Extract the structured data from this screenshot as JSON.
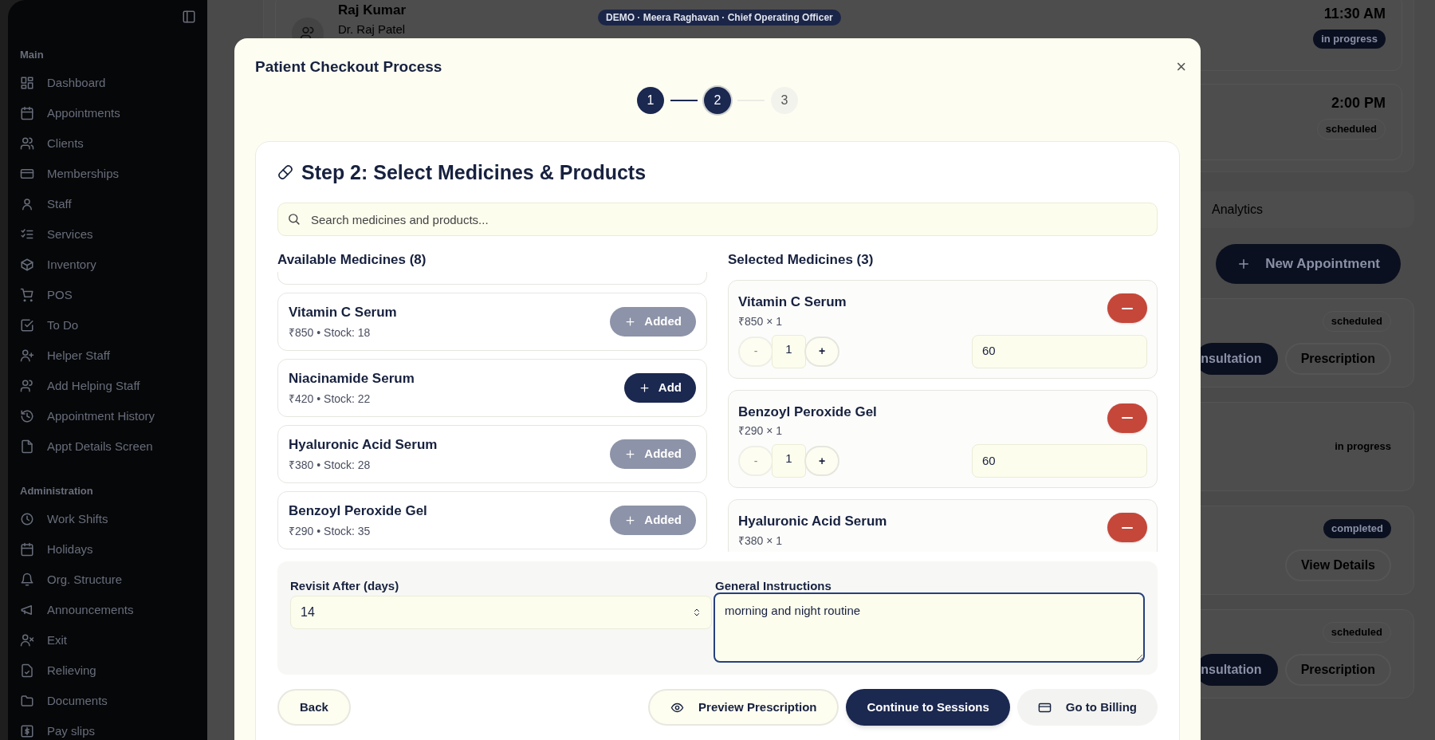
{
  "sidebar": {
    "sections": [
      {
        "title": "Main",
        "items": [
          {
            "label": "Dashboard"
          },
          {
            "label": "Appointments"
          },
          {
            "label": "Clients"
          },
          {
            "label": "Memberships"
          },
          {
            "label": "Staff"
          },
          {
            "label": "Services"
          },
          {
            "label": "Inventory"
          },
          {
            "label": "POS"
          },
          {
            "label": "To Do"
          },
          {
            "label": "Helper Staff"
          },
          {
            "label": "Add Helping Staff"
          },
          {
            "label": "Appointment History"
          },
          {
            "label": "Appt Details Screen"
          }
        ]
      },
      {
        "title": "Administration",
        "items": [
          {
            "label": "Work Shifts"
          },
          {
            "label": "Holidays"
          },
          {
            "label": "Org. Structure"
          },
          {
            "label": "Announcements"
          },
          {
            "label": "Exit"
          },
          {
            "label": "Relieving"
          },
          {
            "label": "Documents"
          },
          {
            "label": "Pay slips"
          }
        ]
      }
    ]
  },
  "demo_badge": "DEMO · Meera Raghavan · Chief Operating Officer",
  "background": {
    "top_cards": [
      {
        "name": "Raj Kumar",
        "doctor": "Dr. Raj Patel",
        "time": "11:30 AM",
        "status": "in progress",
        "status_filled": true
      },
      {
        "time": "2:00 PM",
        "status": "scheduled",
        "status_filled": false
      }
    ],
    "tab_label": "Analytics",
    "new_appointment": "New Appointment",
    "appointments": [
      {
        "status": "scheduled",
        "kind": "outline",
        "buttons": [
          {
            "label": "nsultation",
            "primary": true
          },
          {
            "label": "Prescription",
            "primary": false
          }
        ]
      },
      {
        "status": "in progress",
        "kind": "plain"
      },
      {
        "status": "completed",
        "kind": "filled",
        "buttons": [
          {
            "label": "View Details",
            "primary": false
          }
        ]
      },
      {
        "status": "scheduled",
        "kind": "outline",
        "buttons": [
          {
            "label": "nsultation",
            "primary": true
          },
          {
            "label": "Prescription",
            "primary": false
          }
        ]
      }
    ]
  },
  "modal": {
    "title": "Patient Checkout Process",
    "close": "×",
    "steps": [
      {
        "label": "1",
        "completed": true,
        "selected": false
      },
      {
        "label": "2",
        "completed": false,
        "selected": true
      },
      {
        "label": "3",
        "completed": false,
        "selected": false
      }
    ],
    "heading": "Step 2: Select Medicines & Products",
    "search": {
      "placeholder": "Search medicines and products..."
    },
    "available": {
      "heading": "Available Medicines (8)",
      "items": [
        {
          "name": "Vitamin C Serum",
          "detail": "₹850 • Stock: 18",
          "button": "Added",
          "added": true
        },
        {
          "name": "Niacinamide Serum",
          "detail": "₹420 • Stock: 22",
          "button": "Add",
          "added": false
        },
        {
          "name": "Hyaluronic Acid Serum",
          "detail": "₹380 • Stock: 28",
          "button": "Added",
          "added": true
        },
        {
          "name": "Benzoyl Peroxide Gel",
          "detail": "₹290 • Stock: 35",
          "button": "Added",
          "added": true
        }
      ]
    },
    "selected": {
      "heading": "Selected Medicines (3)",
      "items": [
        {
          "name": "Vitamin C Serum",
          "detail": "₹850 × 1",
          "decrement": "-",
          "quantity": "1",
          "increment": "+",
          "duration": "60"
        },
        {
          "name": "Benzoyl Peroxide Gel",
          "detail": "₹290 × 1",
          "decrement": "-",
          "quantity": "1",
          "increment": "+",
          "duration": "60"
        },
        {
          "name": "Hyaluronic Acid Serum",
          "detail": "₹380 × 1"
        }
      ]
    },
    "revisit": {
      "label": "Revisit After (days)",
      "value": "14"
    },
    "instructions": {
      "label": "General Instructions",
      "value": "morning and night routine",
      "focused": true
    },
    "buttons": [
      {
        "label": "Back",
        "kind": "outline"
      },
      {
        "label": "Preview Prescription",
        "kind": "outline"
      },
      {
        "label": "Continue to Sessions",
        "kind": "primary"
      },
      {
        "label": "Go to Billing",
        "kind": "muted"
      }
    ]
  }
}
